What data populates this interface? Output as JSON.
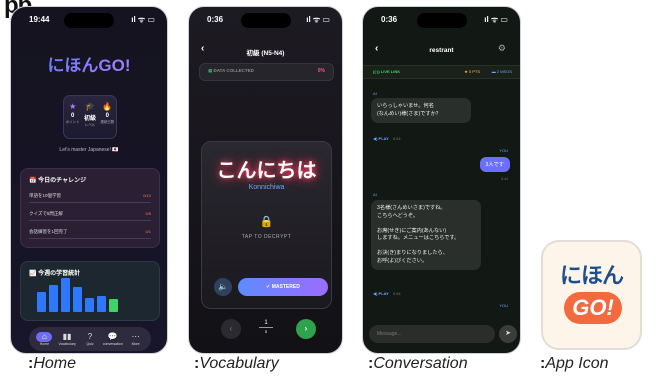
{
  "header_fragment": "pp",
  "home": {
    "time": "19:44",
    "title": "にほんGO!",
    "stats": [
      {
        "icon": "★",
        "value": "0",
        "label": "ポイント"
      },
      {
        "icon": "🎓",
        "value": "初級",
        "label": "レベル"
      },
      {
        "icon": "🔥",
        "value": "0",
        "label": "連続日数"
      }
    ],
    "tagline": "Let's master Japanese! 🇯🇵",
    "challenge_title": "今日のチャレンジ",
    "challenges": [
      {
        "text": "単語を10個学習",
        "progress": "0/10"
      },
      {
        "text": "クイズで5問正解",
        "progress": "0/5"
      },
      {
        "text": "会話練習を1回完了",
        "progress": "0/1"
      }
    ],
    "weekly_title": "今週の学習統計",
    "weekly_bars": [
      0.55,
      0.75,
      0.95,
      0.7,
      0.4,
      0.45,
      0.35
    ],
    "tabs": [
      {
        "icon": "⌂",
        "label": "Home"
      },
      {
        "icon": "▮▮",
        "label": "Vocabulary"
      },
      {
        "icon": "?",
        "label": "Quiz"
      },
      {
        "icon": "💬",
        "label": "conversation"
      },
      {
        "icon": "⋯",
        "label": "More"
      }
    ]
  },
  "vocab": {
    "time": "0:36",
    "title": "初級 (N5-N4)",
    "data_label": "DATA COLLECTED",
    "data_percent": "0%",
    "word": "こんにちは",
    "romaji": "Konnichiwa",
    "decrypt_label": "TAP TO DECRYPT",
    "mastered_label": "✔ MASTERED",
    "page_current": "1",
    "page_total": "5"
  },
  "conv": {
    "time": "0:36",
    "title": "restrant",
    "live_label": "LIVE LINK",
    "pts_label": "★ 0 PTS",
    "msgs_label": "2 MSGS",
    "ai_label": "AI",
    "you_label": "YOU",
    "msg1": "いらっしゃいませ。何名\n(なんめい)様(さま)ですか？",
    "play_label": "◀) PLAY",
    "play_time1": "0:44",
    "msg2": "3人です",
    "time2": "0:44",
    "msg3": "3名様(さんめいさま)ですね。\nこちらへどうぞ。\n\nお席(せき)にご案内(あんない)\nしますね。メニューはこちらです。\n\nお決(き)まりになりましたら、\nお呼(よ)びください。",
    "play_time3": "0:44",
    "composer_placeholder": "Message..."
  },
  "app_icon": {
    "top": "にほん",
    "bottom": "GO!"
  },
  "captions": {
    "home": "Home",
    "vocab": "Vocabulary",
    "conv": "Conversation",
    "icon": "App Icon"
  }
}
